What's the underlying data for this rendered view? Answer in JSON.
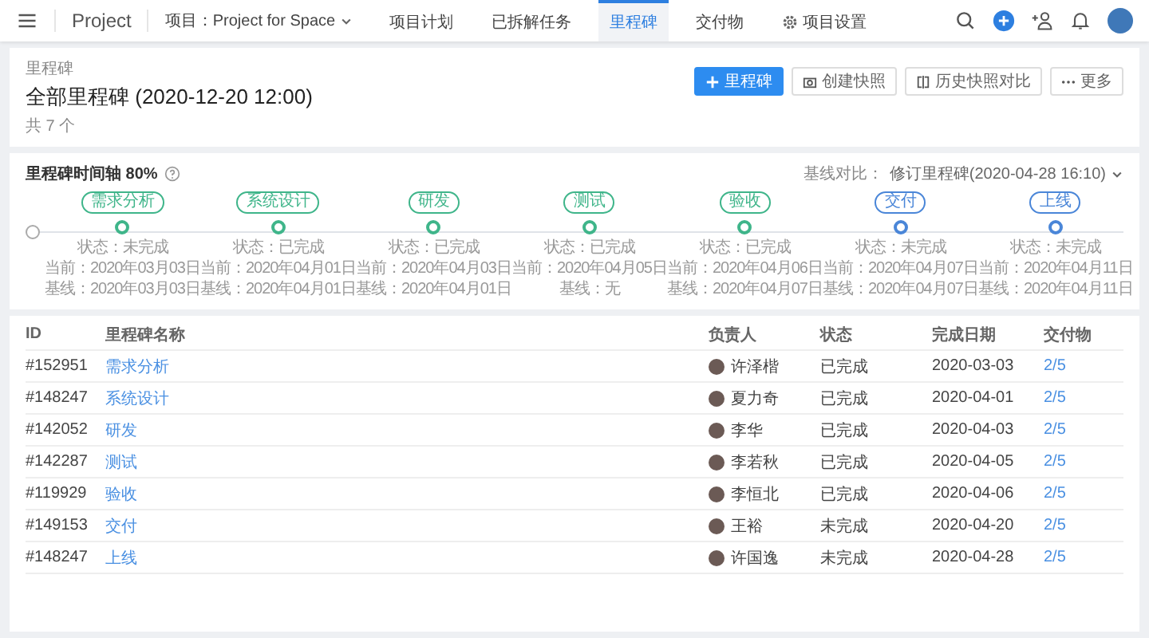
{
  "nav": {
    "brand": "Project",
    "project_selector": "项目：Project for Space",
    "tabs": [
      {
        "label": "项目计划",
        "selected": false,
        "kind": "plain"
      },
      {
        "label": "已拆解任务",
        "selected": false,
        "kind": "plain"
      },
      {
        "label": "里程碑",
        "selected": true,
        "kind": "plain"
      },
      {
        "label": "交付物",
        "selected": false,
        "kind": "plain"
      },
      {
        "label": "项目设置",
        "selected": false,
        "kind": "settings"
      }
    ]
  },
  "header": {
    "breadcrumb": "里程碑",
    "title": "全部里程碑 (2020-12-20 12:00)",
    "count": "共 7 个",
    "buttons": [
      {
        "label": "里程碑",
        "kind": "primary"
      },
      {
        "label": "创建快照",
        "kind": "snapshot"
      },
      {
        "label": "历史快照对比",
        "kind": "compare"
      },
      {
        "label": "更多",
        "kind": "more"
      }
    ]
  },
  "timeline": {
    "title": "里程碑时间轴 80%",
    "baseline_label": "基线对比：",
    "baseline_value": "修订里程碑(2020-04-28 16:10)",
    "milestones": [
      {
        "name": "需求分析",
        "color": "#3fb58a",
        "status": "状态：未完成",
        "current": "当前：2020年03月03日",
        "baseline": "基线：2020年03月03日"
      },
      {
        "name": "系统设计",
        "color": "#3fb58a",
        "status": "状态：已完成",
        "current": "当前：2020年04月01日",
        "baseline": "基线：2020年04月01日"
      },
      {
        "name": "研发",
        "color": "#3fb58a",
        "status": "状态：已完成",
        "current": "当前：2020年04月03日",
        "baseline": "基线：2020年04月01日"
      },
      {
        "name": "测试",
        "color": "#3fb58a",
        "status": "状态：已完成",
        "current": "当前：2020年04月05日",
        "baseline": "基线：无"
      },
      {
        "name": "验收",
        "color": "#3fb58a",
        "status": "状态：已完成",
        "current": "当前：2020年04月06日",
        "baseline": "基线：2020年04月07日"
      },
      {
        "name": "交付",
        "color": "#4a86d8",
        "status": "状态：未完成",
        "current": "当前：2020年04月07日",
        "baseline": "基线：2020年04月07日"
      },
      {
        "name": "上线",
        "color": "#4a86d8",
        "status": "状态：未完成",
        "current": "当前：2020年04月11日",
        "baseline": "基线：2020年04月11日"
      }
    ]
  },
  "table": {
    "columns": [
      "ID",
      "里程碑名称",
      "负责人",
      "状态",
      "完成日期",
      "交付物"
    ],
    "rows": [
      {
        "id": "#152951",
        "name": "需求分析",
        "owner": "许泽楷",
        "status": "已完成",
        "date": "2020-03-03",
        "deliverables": "2/5"
      },
      {
        "id": "#148247",
        "name": "系统设计",
        "owner": "夏力奇",
        "status": "已完成",
        "date": "2020-04-01",
        "deliverables": "2/5"
      },
      {
        "id": "#142052",
        "name": "研发",
        "owner": "李华",
        "status": "已完成",
        "date": "2020-04-03",
        "deliverables": "2/5"
      },
      {
        "id": "#142287",
        "name": "测试",
        "owner": "李若秋",
        "status": "已完成",
        "date": "2020-04-05",
        "deliverables": "2/5"
      },
      {
        "id": "#119929",
        "name": "验收",
        "owner": "李恒北",
        "status": "已完成",
        "date": "2020-04-06",
        "deliverables": "2/5"
      },
      {
        "id": "#149153",
        "name": "交付",
        "owner": "王裕",
        "status": "未完成",
        "date": "2020-04-20",
        "deliverables": "2/5"
      },
      {
        "id": "#148247",
        "name": "上线",
        "owner": "许国逸",
        "status": "未完成",
        "date": "2020-04-28",
        "deliverables": "2/5"
      }
    ]
  }
}
